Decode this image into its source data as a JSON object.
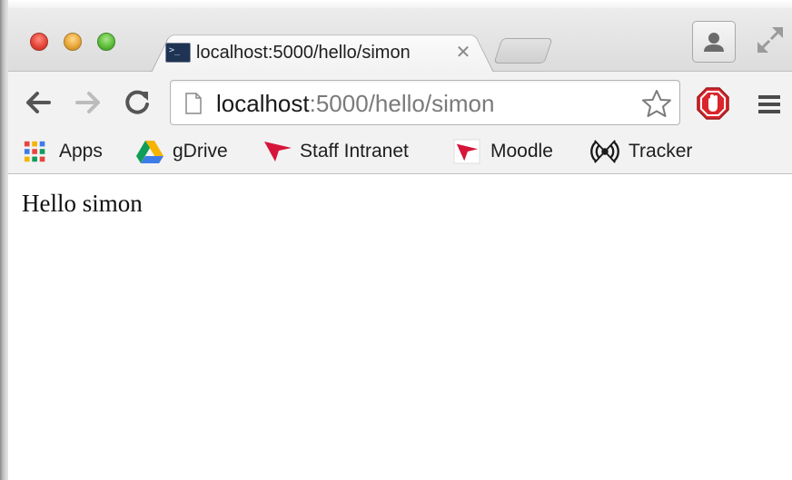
{
  "tab": {
    "title": "localhost:5000/hello/simon",
    "favicon_glyph": ">_",
    "close_glyph": "✕"
  },
  "omnibox": {
    "url_host": "localhost",
    "url_rest": ":5000/hello/simon"
  },
  "bookmarks": {
    "items": [
      {
        "label": "Apps",
        "icon": "apps-grid-icon"
      },
      {
        "label": "gDrive",
        "icon": "google-drive-icon"
      },
      {
        "label": "Staff Intranet",
        "icon": "red-flag-icon"
      },
      {
        "label": "Moodle",
        "icon": "moodle-icon"
      },
      {
        "label": "Tracker",
        "icon": "tracker-icon"
      }
    ]
  },
  "page": {
    "body_text": "Hello simon"
  },
  "colors": {
    "chrome_bg": "#f2f2f2",
    "tabstrip_bg": "#dcdcdc",
    "url_host": "#1a1a1a",
    "url_rest": "#7a7a7a",
    "adblock_red": "#d9262b",
    "bookmark_red": "#d6153a"
  }
}
